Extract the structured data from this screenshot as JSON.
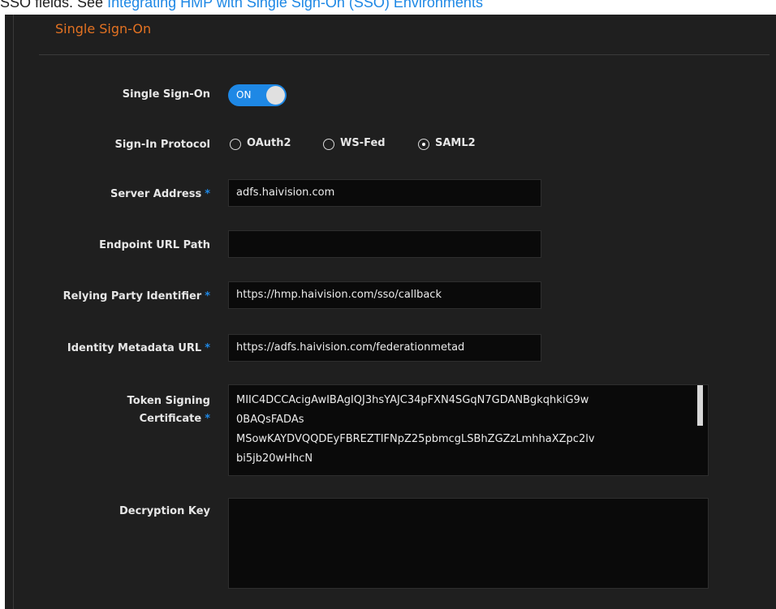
{
  "doc": {
    "prefix": "SSO fields. See ",
    "link_text": "Integrating HMP with Single Sign-On (SSO) Environments"
  },
  "section": {
    "title": "Single Sign-On"
  },
  "form": {
    "sso": {
      "label": "Single Sign-On",
      "toggle_text": "ON",
      "enabled": true
    },
    "protocol": {
      "label": "Sign-In Protocol",
      "options": [
        "OAuth2",
        "WS-Fed",
        "SAML2"
      ],
      "selected": "SAML2"
    },
    "server_address": {
      "label": "Server Address",
      "required_mark": "*",
      "value": "adfs.haivision.com"
    },
    "endpoint_url": {
      "label": "Endpoint URL Path",
      "value": ""
    },
    "relying_party": {
      "label": "Relying Party Identifier",
      "required_mark": "*",
      "value": "https://hmp.haivision.com/sso/callback"
    },
    "metadata_url": {
      "label": "Identity Metadata URL",
      "required_mark": "*",
      "value": "https://adfs.haivision.com/federationmetad"
    },
    "token_cert": {
      "label_line1": "Token Signing",
      "label_line2": "Certificate",
      "required_mark": "*",
      "lines": [
        "MIIC4DCCAcigAwIBAgIQJ3hsYAJC34pFXN4SGqN7GDANBgkqhkiG9w",
        "0BAQsFADAs",
        "MSowKAYDVQQDEyFBREZTIFNpZ25pbmcgLSBhZGZzLmhhaXZpc2lv",
        "bi5jb20wHhcN"
      ]
    },
    "decryption_key": {
      "label": "Decryption Key",
      "value": ""
    }
  },
  "colors": {
    "accent": "#1e88e5",
    "title": "#e37222",
    "panel": "#1f1f1f"
  }
}
